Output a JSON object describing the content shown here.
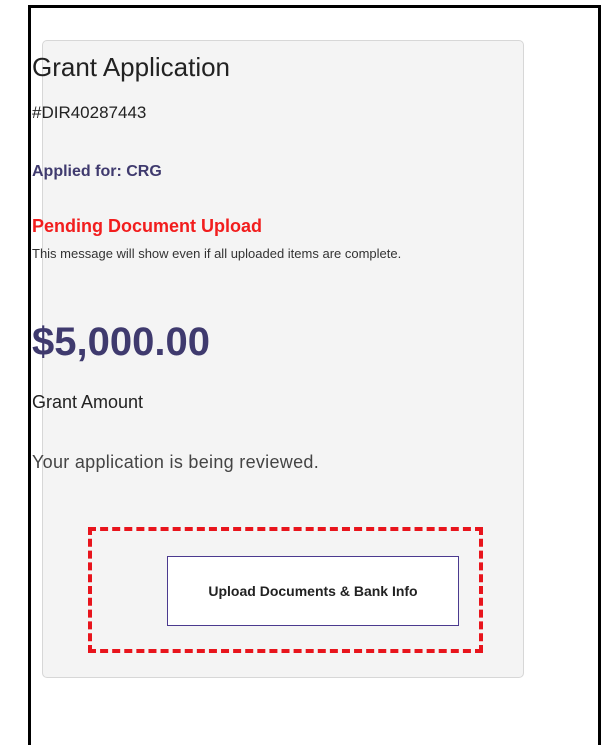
{
  "card": {
    "title": "Grant Application",
    "application_id": "#DIR40287443",
    "applied_for": "Applied for: CRG",
    "status": "Pending Document Upload",
    "status_note": "This message will show even if all uploaded items are complete.",
    "amount": "$5,000.00",
    "amount_label": "Grant Amount",
    "review_message": "Your application is being reviewed.",
    "upload_button_label": "Upload Documents & Bank Info"
  },
  "colors": {
    "accent": "#3f3a6e",
    "status_red": "#f21d1d",
    "highlight_dashed": "#e8141c",
    "button_border": "#4b3a8f",
    "card_background": "#f4f4f4"
  }
}
